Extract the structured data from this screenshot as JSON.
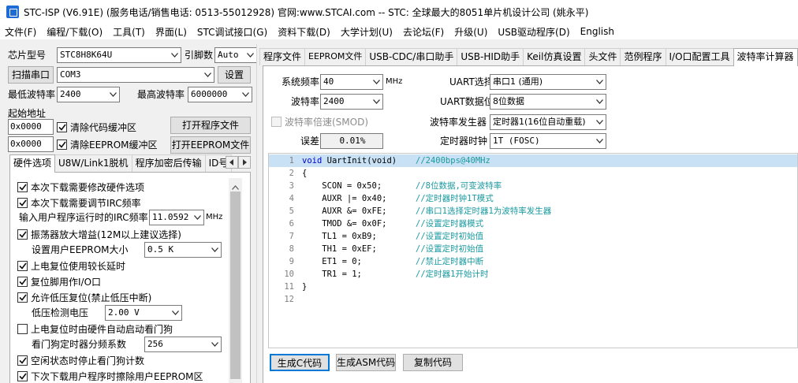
{
  "window": {
    "title": "STC-ISP (V6.91E) (服务电话/销售电话: 0513-55012928) 官网:www.STCAI.com  -- STC: 全球最大的8051单片机设计公司 (姚永平)"
  },
  "menu": [
    "文件(F)",
    "编程/下载(O)",
    "工具(T)",
    "界面(L)",
    "STC调试接口(G)",
    "资料下载(D)",
    "大学计划(U)",
    "去论坛(F)",
    "升级(U)",
    "USB驱动程序(D)",
    "English"
  ],
  "left": {
    "chip_label": "芯片型号",
    "chip_value": "STC8H8K64U",
    "pin_label": "引脚数",
    "pin_value": "Auto",
    "scan_button": "扫描串口",
    "port_value": "COM3",
    "settings_button": "设置",
    "min_baud_label": "最低波特率",
    "min_baud_value": "2400",
    "max_baud_label": "最高波特率",
    "max_baud_value": "6000000",
    "start_addr_label": "起始地址",
    "addr1_value": "0x0000",
    "clear_code_label": "清除代码缓冲区",
    "open_prog_button": "打开程序文件",
    "addr2_value": "0x0000",
    "clear_eeprom_label": "清除EEPROM缓冲区",
    "open_eeprom_button": "打开EEPROM文件",
    "tabs": [
      "硬件选项",
      "U8W/Link1脱机",
      "程序加密后传输",
      "ID号"
    ],
    "options": {
      "opt1": "本次下载需要修改硬件选项",
      "opt2": "本次下载需要调节IRC频率",
      "irc_label": "输入用户程序运行时的IRC频率",
      "irc_value": "11.0592",
      "irc_unit": "MHz",
      "opt3": "振荡器放大增益(12M以上建议选择)",
      "eeprom_size_label": "设置用户EEPROM大小",
      "eeprom_size_value": "0.5 K",
      "opt4": "上电复位使用较长延时",
      "opt5": "复位脚用作I/O口",
      "opt6": "允许低压复位(禁止低压中断)",
      "lvd_label": "低压检测电压",
      "lvd_value": "2.00 V",
      "opt7": "上电复位时由硬件自动启动看门狗",
      "wdt_label": "看门狗定时器分频系数",
      "wdt_value": "256",
      "opt8": "空闲状态时停止看门狗计数",
      "opt9": "下次下载用户程序时擦除用户EEPROM区"
    }
  },
  "right": {
    "tabs": [
      "程序文件",
      "EEPROM文件",
      "USB-CDC/串口助手",
      "USB-HID助手",
      "Keil仿真设置",
      "头文件",
      "范例程序",
      "I/O口配置工具",
      "波特率计算器"
    ],
    "sysfreq_label": "系统频率",
    "sysfreq_value": "40",
    "sysfreq_unit": "MHz",
    "baud_label": "波特率",
    "baud_value": "2400",
    "smod_label": "波特率倍速(SMOD)",
    "error_label": "误差",
    "error_value": "0.01%",
    "uart_sel_label": "UART选择",
    "uart_sel_value": "串口1 (通用)",
    "uart_bits_label": "UART数据位",
    "uart_bits_value": "8位数据",
    "baud_gen_label": "波特率发生器",
    "baud_gen_value": "定时器1(16位自动重载)",
    "timer_clk_label": "定时器时钟",
    "timer_clk_value": "1T  (FOSC)",
    "code_lines": [
      {
        "num": "1",
        "code": "UartInit(void)",
        "kw": "void",
        "cmt": "//2400bps@40MHz"
      },
      {
        "num": "2",
        "code": "{",
        "kw": "",
        "cmt": ""
      },
      {
        "num": "3",
        "code": "    SCON = 0x50;",
        "kw": "",
        "cmt": "//8位数据,可变波特率"
      },
      {
        "num": "4",
        "code": "    AUXR |= 0x40;",
        "kw": "",
        "cmt": "//定时器时钟1T模式"
      },
      {
        "num": "5",
        "code": "    AUXR &= 0xFE;",
        "kw": "",
        "cmt": "//串口1选择定时器1为波特率发生器"
      },
      {
        "num": "6",
        "code": "    TMOD &= 0x0F;",
        "kw": "",
        "cmt": "//设置定时器模式"
      },
      {
        "num": "7",
        "code": "    TL1 = 0xB9;",
        "kw": "",
        "cmt": "//设置定时初始值"
      },
      {
        "num": "8",
        "code": "    TH1 = 0xEF;",
        "kw": "",
        "cmt": "//设置定时初始值"
      },
      {
        "num": "9",
        "code": "    ET1 = 0;",
        "kw": "",
        "cmt": "//禁止定时器中断"
      },
      {
        "num": "10",
        "code": "    TR1 = 1;",
        "kw": "",
        "cmt": "//定时器1开始计时"
      },
      {
        "num": "11",
        "code": "}",
        "kw": "",
        "cmt": ""
      },
      {
        "num": "12",
        "code": "",
        "kw": "",
        "cmt": ""
      }
    ],
    "gen_c_button": "生成C代码",
    "gen_asm_button": "生成ASM代码",
    "copy_button": "复制代码"
  },
  "colors": {
    "accent": "#1e6bd6",
    "comment": "#1a9aa0",
    "keyword": "#0000d0",
    "highlight_line": "#c8e1f4"
  }
}
